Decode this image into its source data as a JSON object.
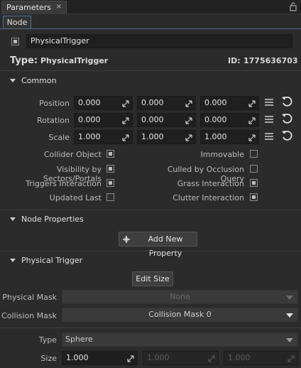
{
  "window": {
    "title": "Parameters",
    "close_glyph": "×"
  },
  "tabs": {
    "node": "Node"
  },
  "node": {
    "name": "PhysicalTrigger",
    "type_label": "Type:",
    "type_value": "PhysicalTrigger",
    "id_label": "ID:",
    "id_value": "1775636703"
  },
  "common": {
    "header": "Common",
    "rows": [
      {
        "label": "Position",
        "values": [
          "0.000",
          "0.000",
          "0.000"
        ]
      },
      {
        "label": "Rotation",
        "values": [
          "0.000",
          "0.000",
          "0.000"
        ]
      },
      {
        "label": "Scale",
        "values": [
          "1.000",
          "1.000",
          "1.000"
        ]
      }
    ],
    "flags": {
      "collider_object": "Collider Object",
      "immovable": "Immovable",
      "visibility_sectors": "Visibility by Sectors/Portals",
      "culled_occlusion": "Culled by Occlusion Query",
      "triggers_interaction": "Triggers Interaction",
      "grass_interaction": "Grass Interaction",
      "updated_last": "Updated Last",
      "clutter_interaction": "Clutter Interaction"
    }
  },
  "node_properties": {
    "header": "Node Properties",
    "add_button": "Add New Property"
  },
  "physical_trigger": {
    "header": "Physical Trigger",
    "edit_size": "Edit Size",
    "physical_mask_label": "Physical Mask",
    "physical_mask_value": "None",
    "collision_mask_label": "Collision Mask",
    "collision_mask_value": "Collision Mask 0",
    "type_label": "Type",
    "type_value": "Sphere",
    "size_label": "Size",
    "size_values": [
      "1.000",
      "1.000",
      "1.000"
    ]
  }
}
